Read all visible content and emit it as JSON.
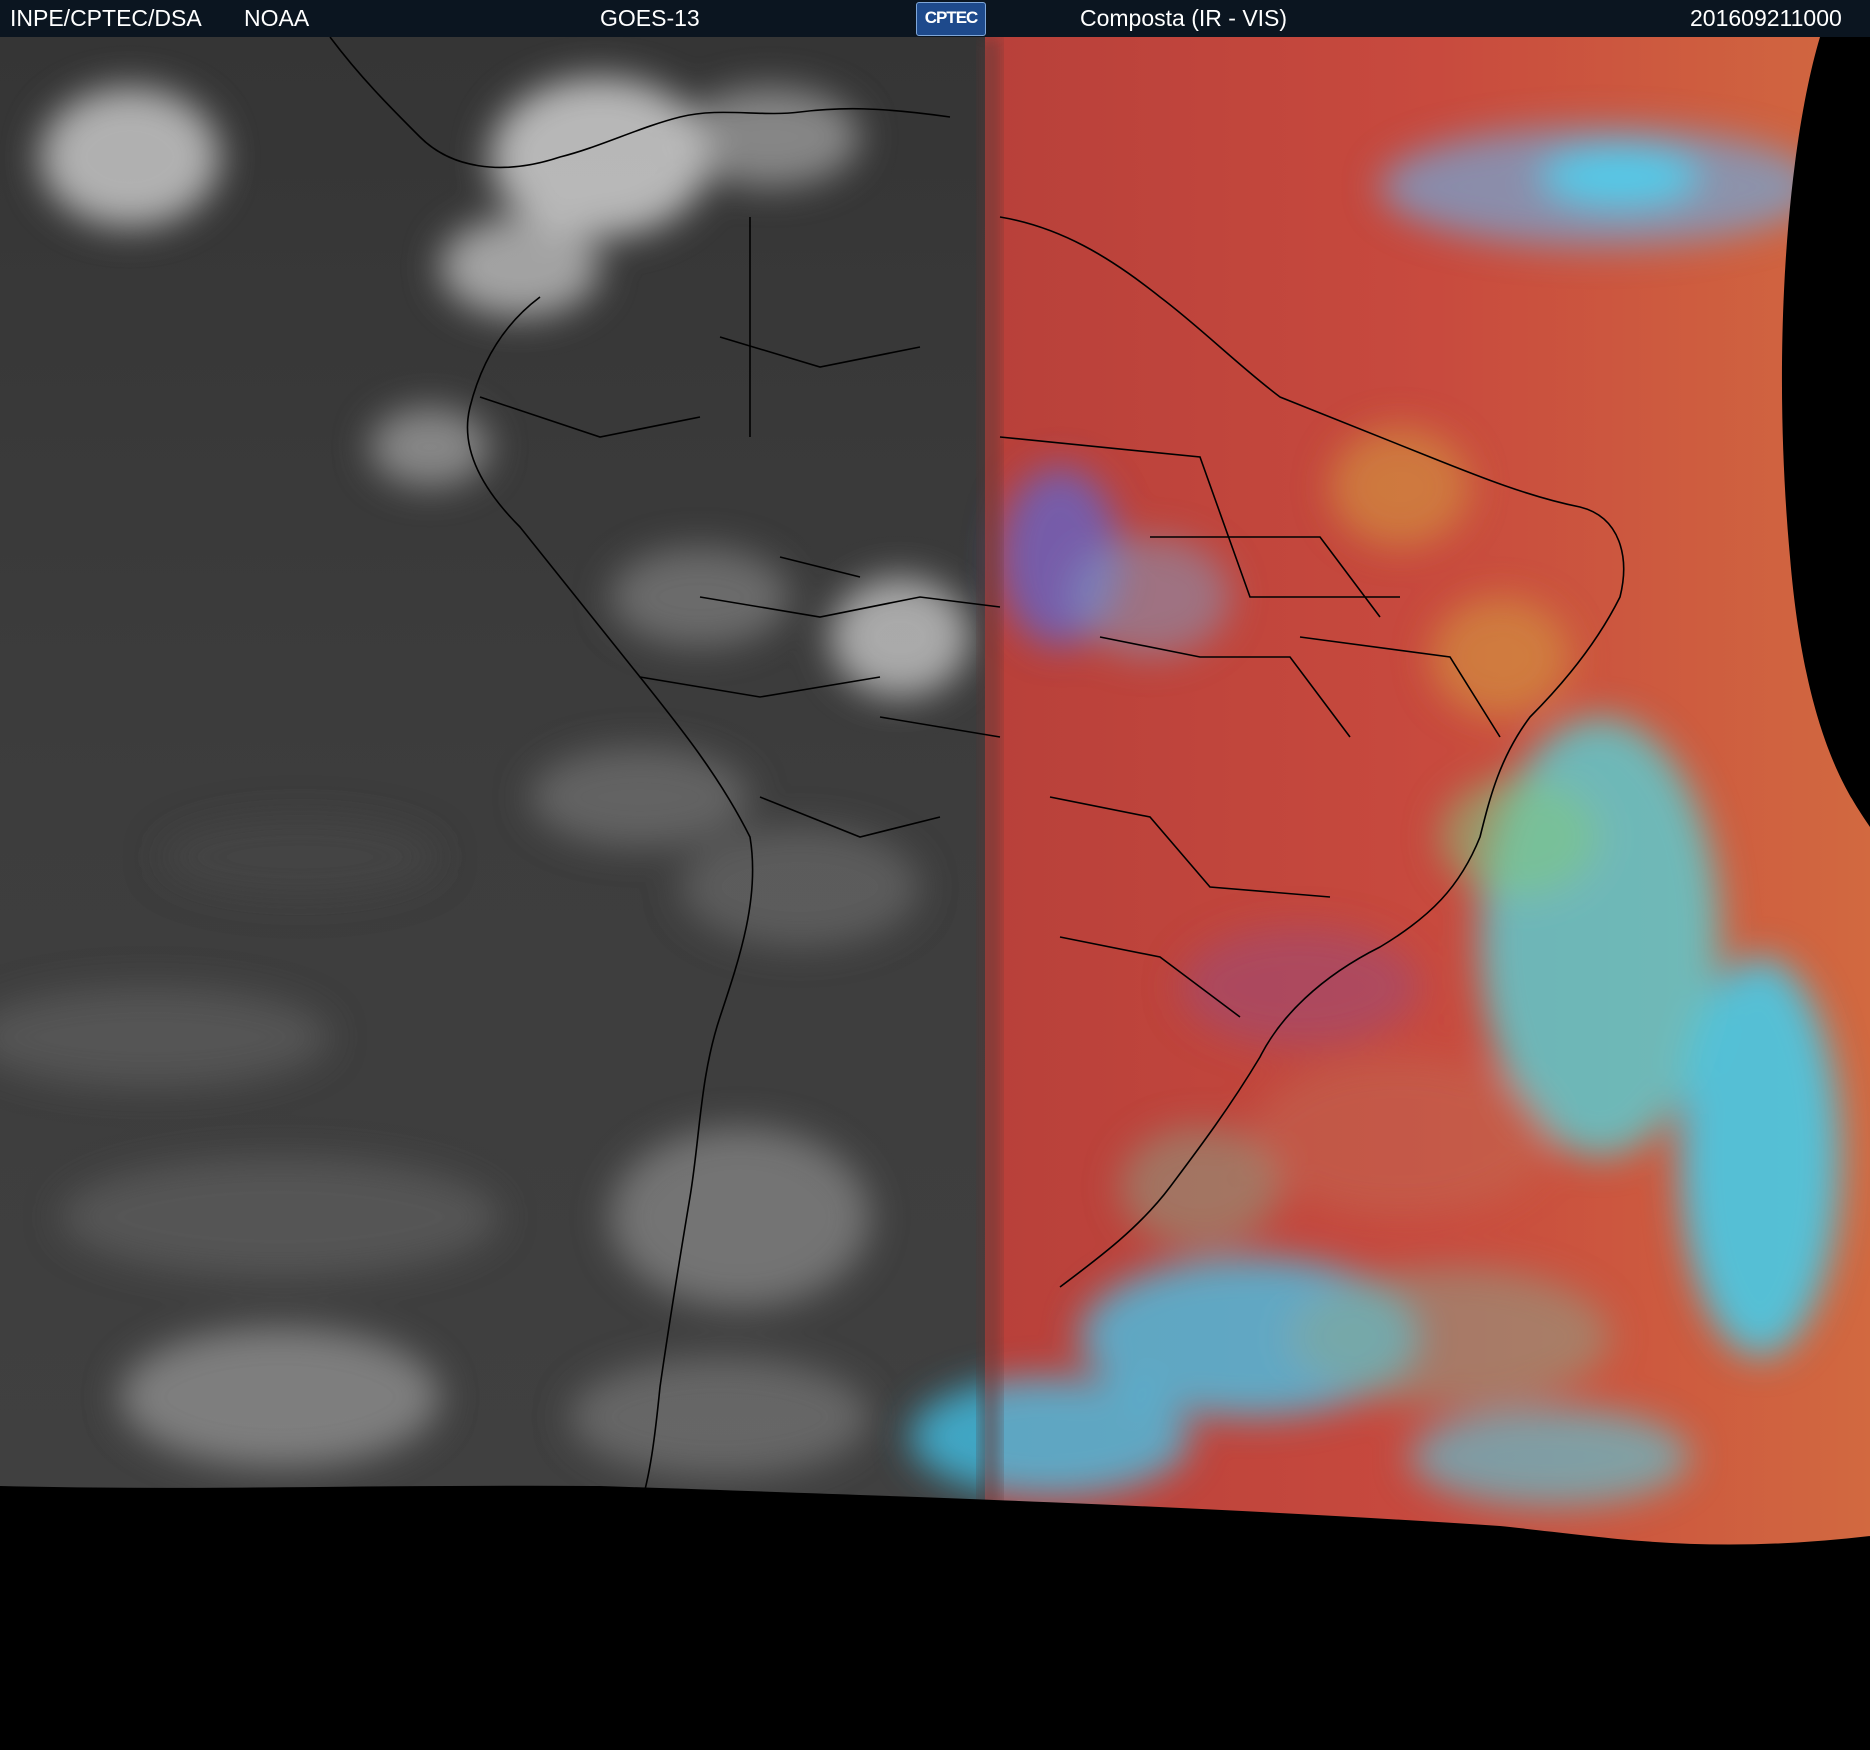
{
  "header": {
    "agency": "INPE/CPTEC/DSA",
    "provider": "NOAA",
    "satellite": "GOES-13",
    "logo_text": "CPTEC",
    "product": "Composta (IR - VIS)",
    "timestamp": "201609211000"
  },
  "colors": {
    "header_bg": "#0b1520",
    "header_text": "#ffffff",
    "ir_background": "#3c3c3c",
    "ir_clouds": "#d8d8d8",
    "composite_land": "#c9473f",
    "composite_ocean": "#d45a3f",
    "composite_clouds_cyan": "#3fd8f0",
    "composite_clouds_purple": "#9a4a7a",
    "no_data": "#000000",
    "borders": "#000000"
  },
  "icons": {
    "logo": "cptec-logo"
  }
}
